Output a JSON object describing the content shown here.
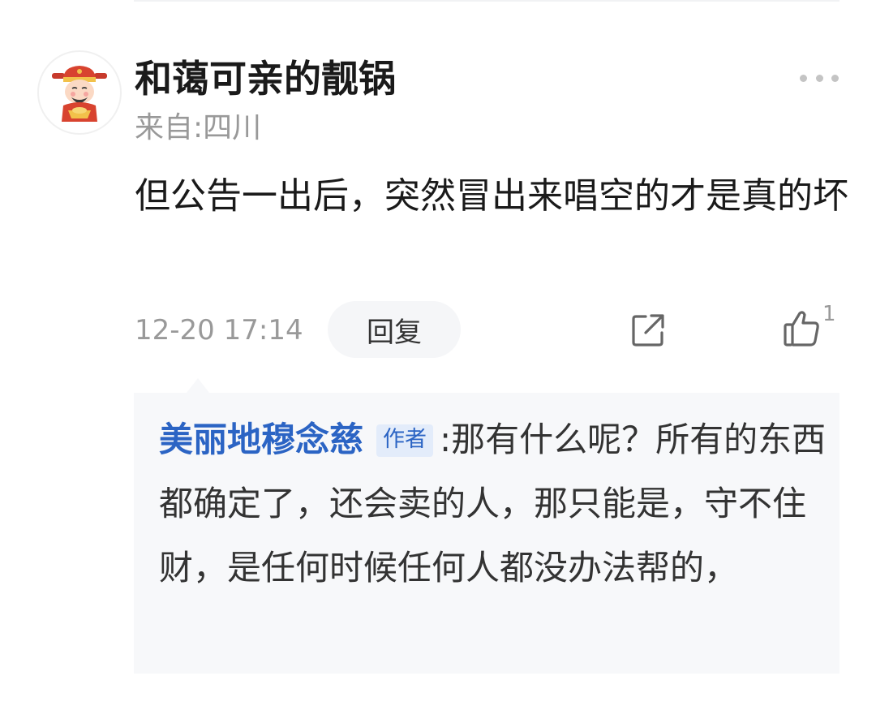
{
  "comment": {
    "username": "和蔼可亲的靓锅",
    "location": "来自:四川",
    "text": "但公告一出后，突然冒出来唱空的才是真的坏",
    "timestamp": "12-20 17:14",
    "reply_label": "回复",
    "like_count": "1",
    "icons": {
      "avatar": "cartoon-god-of-wealth-avatar",
      "more": "more-dots-icon",
      "share": "share-icon",
      "like": "thumbs-up-icon"
    }
  },
  "reply": {
    "author": "美丽地穆念慈",
    "badge": "作者",
    "text": ":那有什么呢？所有的东西都确定了，还会卖的人，那只能是，守不住财，是任何时候任何人都没办法帮的，"
  },
  "colors": {
    "author_blue": "#2b64c4",
    "muted_gray": "#999999",
    "reply_background": "#f7f8fa"
  }
}
